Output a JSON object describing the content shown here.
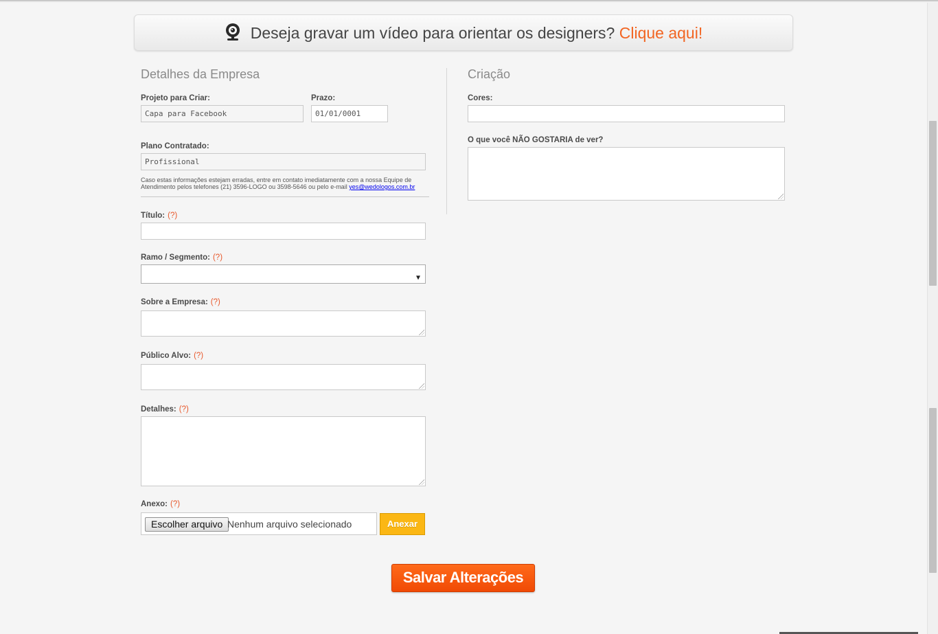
{
  "banner": {
    "text": "Deseja gravar um vídeo para orientar os designers?",
    "link": "Clique aqui!",
    "icon": "webcam-icon"
  },
  "left": {
    "section_title": "Detalhes da Empresa",
    "project_label": "Projeto para Criar:",
    "project_value": "Capa para Facebook",
    "deadline_label": "Prazo:",
    "deadline_value": "01/01/0001",
    "plan_label": "Plano Contratado:",
    "plan_value": "Profissional",
    "notice_text": "Caso estas informações estejam erradas, entre em contato imediatamente com a nossa Equipe de Atendimento pelos telefones (21) 3596-LOGO ou 3598-5646 ou pelo e-mail ",
    "notice_email": "yes@wedologos.com.br",
    "title_label": "Título:",
    "help": "(?)",
    "segment_label": "Ramo / Segmento:",
    "segment_value": "",
    "about_label": "Sobre a Empresa:",
    "audience_label": "Público Alvo:",
    "details_label": "Detalhes:",
    "attachment_label": "Anexo:",
    "choose_file": "Escolher arquivo",
    "no_file": "Nenhum arquivo selecionado",
    "attach_button": "Anexar"
  },
  "right": {
    "section_title": "Criação",
    "colors_label": "Cores:",
    "dislike_label": "O que você NÃO GOSTARIA de ver?"
  },
  "save_button": "Salvar Alterações",
  "colors": {
    "accent": "#f26522",
    "attach": "#fbb714",
    "save": "#f04a05"
  }
}
